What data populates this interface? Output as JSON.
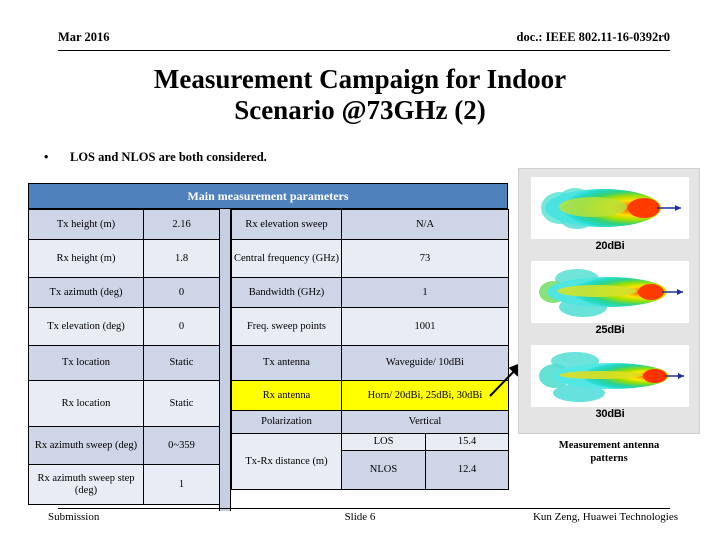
{
  "header": {
    "date": "Mar 2016",
    "doc": "doc.: IEEE 802.11-16-0392r0"
  },
  "title": {
    "line1": "Measurement Campaign for Indoor",
    "line2": "Scenario @73GHz (2)"
  },
  "bullets": [
    {
      "marker": "•",
      "text": "LOS and NLOS are both considered."
    }
  ],
  "table": {
    "caption": "Main measurement parameters",
    "header_color": "#4F81BD",
    "highlight_color": "#FFFF00",
    "row_colors": [
      "#CDD5E6",
      "#E8ECF4"
    ],
    "left": [
      {
        "label": "Tx height (m)",
        "value": "2.16"
      },
      {
        "label": "Rx height (m)",
        "value": "1.8"
      },
      {
        "label": "Tx azimuth (deg)",
        "value": "0"
      },
      {
        "label": "Tx elevation (deg)",
        "value": "0"
      },
      {
        "label": "Tx location",
        "value": "Static"
      },
      {
        "label": "Rx location",
        "value": "Static"
      },
      {
        "label": "Rx azimuth sweep (deg)",
        "value": "0~359"
      },
      {
        "label": "Rx azimuth sweep step (deg)",
        "value": "1"
      }
    ],
    "right": [
      {
        "label": "Rx elevation sweep",
        "value": "N/A"
      },
      {
        "label": "Central frequency (GHz)",
        "value": "73"
      },
      {
        "label": "Bandwidth (GHz)",
        "value": "1"
      },
      {
        "label": "Freq. sweep points",
        "value": "1001"
      },
      {
        "label": "Tx antenna",
        "value": "Waveguide/ 10dBi"
      },
      {
        "label": "Rx antenna",
        "value": "Horn/ 20dBi,  25dBi,  30dBi",
        "highlight": true
      },
      {
        "label": "Polarization",
        "value": "Vertical"
      }
    ],
    "distance": {
      "label": "Tx-Rx distance (m)",
      "rows": [
        {
          "condition": "LOS",
          "value": "15.4"
        },
        {
          "condition": "NLOS",
          "value": "12.4"
        }
      ]
    }
  },
  "antenna_panel": {
    "caption_line1": "Measurement antenna",
    "caption_line2": "patterns",
    "patterns": [
      {
        "label": "20dBi"
      },
      {
        "label": "25dBi"
      },
      {
        "label": "30dBi"
      }
    ]
  },
  "footer": {
    "left": "Submission",
    "center": "Slide 6",
    "right": "Kun Zeng, Huawei Technologies"
  }
}
